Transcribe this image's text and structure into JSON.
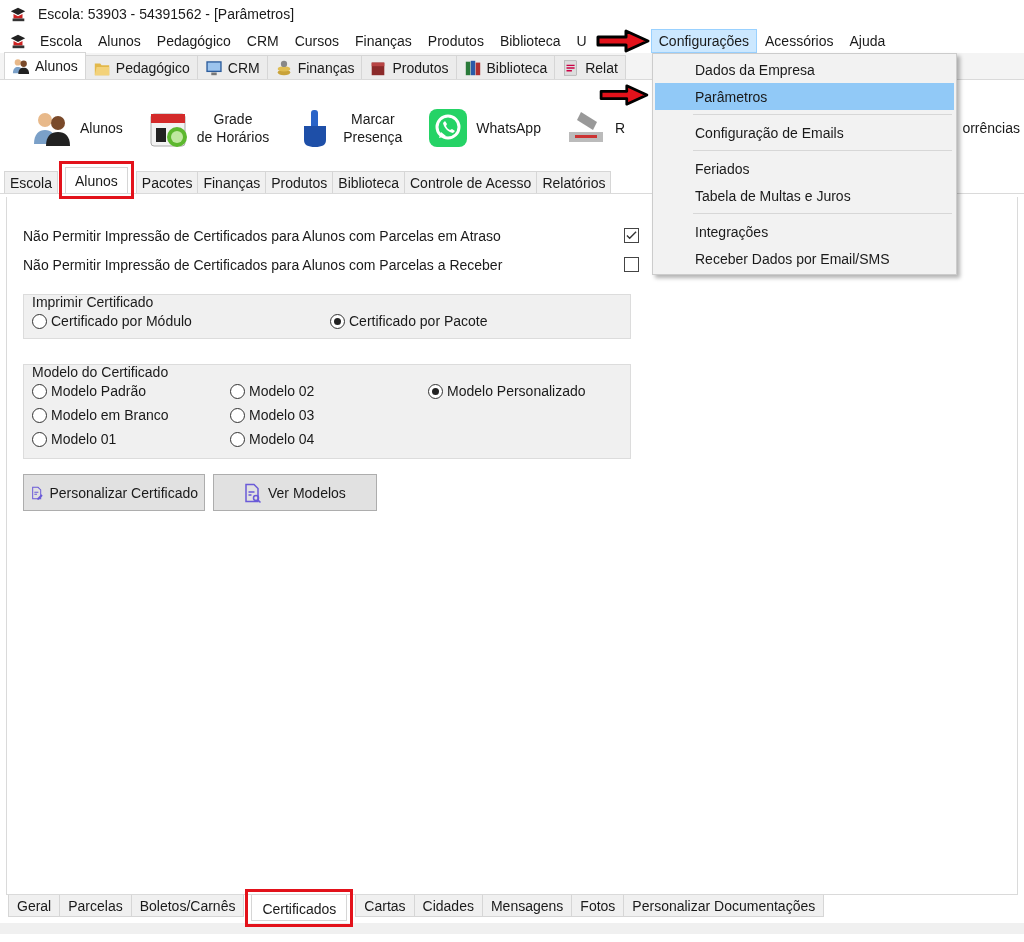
{
  "window": {
    "title": "Escola: 53903 - 54391562 - [Parâmetros]"
  },
  "menu_bar": [
    {
      "label": "Escola",
      "selected": false
    },
    {
      "label": "Alunos",
      "selected": false
    },
    {
      "label": "Pedagógico",
      "selected": false
    },
    {
      "label": "CRM",
      "selected": false
    },
    {
      "label": "Cursos",
      "selected": false
    },
    {
      "label": "Finanças",
      "selected": false
    },
    {
      "label": "Produtos",
      "selected": false
    },
    {
      "label": "Biblioteca",
      "selected": false
    },
    {
      "label": "U",
      "selected": false
    },
    {
      "label": "Configurações",
      "selected": true
    },
    {
      "label": "Acessórios",
      "selected": false
    },
    {
      "label": "Ajuda",
      "selected": false
    }
  ],
  "ribbon_tabs": [
    {
      "label": "Alunos",
      "selected": true
    },
    {
      "label": "Pedagógico",
      "selected": false
    },
    {
      "label": "CRM",
      "selected": false
    },
    {
      "label": "Finanças",
      "selected": false
    },
    {
      "label": "Produtos",
      "selected": false
    },
    {
      "label": "Biblioteca",
      "selected": false
    },
    {
      "label": "Relat",
      "selected": false
    }
  ],
  "toolbar": [
    {
      "label": "Alunos"
    },
    {
      "label": "Grade\nde Horários"
    },
    {
      "label": "Marcar\nPresença"
    },
    {
      "label": "WhatsApp"
    },
    {
      "label": "R"
    },
    {
      "label": "orrências"
    }
  ],
  "dropdown": {
    "groups": [
      [
        {
          "label": "Dados da Empresa",
          "selected": false
        },
        {
          "label": "Parâmetros",
          "selected": true
        }
      ],
      [
        {
          "label": "Configuração de Emails",
          "selected": false
        }
      ],
      [
        {
          "label": "Feriados",
          "selected": false
        },
        {
          "label": "Tabela de Multas e Juros",
          "selected": false
        }
      ],
      [
        {
          "label": "Integrações",
          "selected": false
        },
        {
          "label": "Receber Dados por Email/SMS",
          "selected": false
        }
      ]
    ]
  },
  "sub_tabs": [
    {
      "label": "Escola",
      "selected": false
    },
    {
      "label": "Alunos",
      "selected": true
    },
    {
      "label": "Pacotes",
      "selected": false
    },
    {
      "label": "Finanças",
      "selected": false
    },
    {
      "label": "Produtos",
      "selected": false
    },
    {
      "label": "Biblioteca",
      "selected": false
    },
    {
      "label": "Controle de Acesso",
      "selected": false
    },
    {
      "label": "Relatórios",
      "selected": false
    }
  ],
  "options": [
    {
      "label": "Não Permitir Impressão de Certificados para Alunos com Parcelas em Atraso",
      "checked": true
    },
    {
      "label": "Não Permitir Impressão de Certificados para Alunos com Parcelas a Receber",
      "checked": false
    }
  ],
  "print_group": {
    "title": "Imprimir Certificado",
    "options": [
      {
        "label": "Certificado por Módulo",
        "selected": false
      },
      {
        "label": "Certificado por Pacote",
        "selected": true
      }
    ]
  },
  "model_group": {
    "title": "Modelo do Certificado",
    "options": [
      {
        "label": "Modelo Padrão",
        "selected": false
      },
      {
        "label": "Modelo em Branco",
        "selected": false
      },
      {
        "label": "Modelo 01",
        "selected": false
      },
      {
        "label": "Modelo 02",
        "selected": false
      },
      {
        "label": "Modelo 03",
        "selected": false
      },
      {
        "label": "Modelo 04",
        "selected": false
      },
      {
        "label": "Modelo Personalizado",
        "selected": true
      }
    ]
  },
  "buttons": [
    {
      "label": "Personalizar Certificado"
    },
    {
      "label": "Ver Modelos"
    }
  ],
  "bottom_tabs": [
    {
      "label": "Geral",
      "selected": false
    },
    {
      "label": "Parcelas",
      "selected": false
    },
    {
      "label": "Boletos/Carnês",
      "selected": false
    },
    {
      "label": "Certificados",
      "selected": true
    },
    {
      "label": "Cartas",
      "selected": false
    },
    {
      "label": "Cidades",
      "selected": false
    },
    {
      "label": "Mensagens",
      "selected": false
    },
    {
      "label": "Fotos",
      "selected": false
    },
    {
      "label": "Personalizar Documentações",
      "selected": false
    }
  ]
}
